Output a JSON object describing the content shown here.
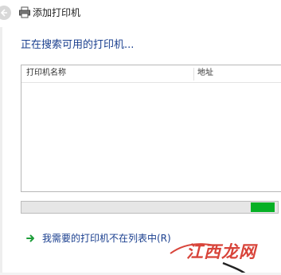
{
  "titlebar": {
    "title": "添加打印机",
    "back_icon": "back-arrow-icon",
    "app_icon": "printer-icon"
  },
  "status": {
    "searching": "正在搜索可用的打印机..."
  },
  "printer_list": {
    "columns": [
      "打印机名称",
      "地址"
    ],
    "rows": []
  },
  "progress": {
    "fill_color": "#06b025"
  },
  "link": {
    "label": "我需要的打印机不在列表中(R)",
    "icon": "green-arrow-icon"
  },
  "watermark": {
    "text": "江西龙网"
  },
  "colors": {
    "link": "#1a3f8f",
    "heading": "#1a3f8f",
    "progress": "#06b025",
    "watermark": "#d8443a"
  }
}
